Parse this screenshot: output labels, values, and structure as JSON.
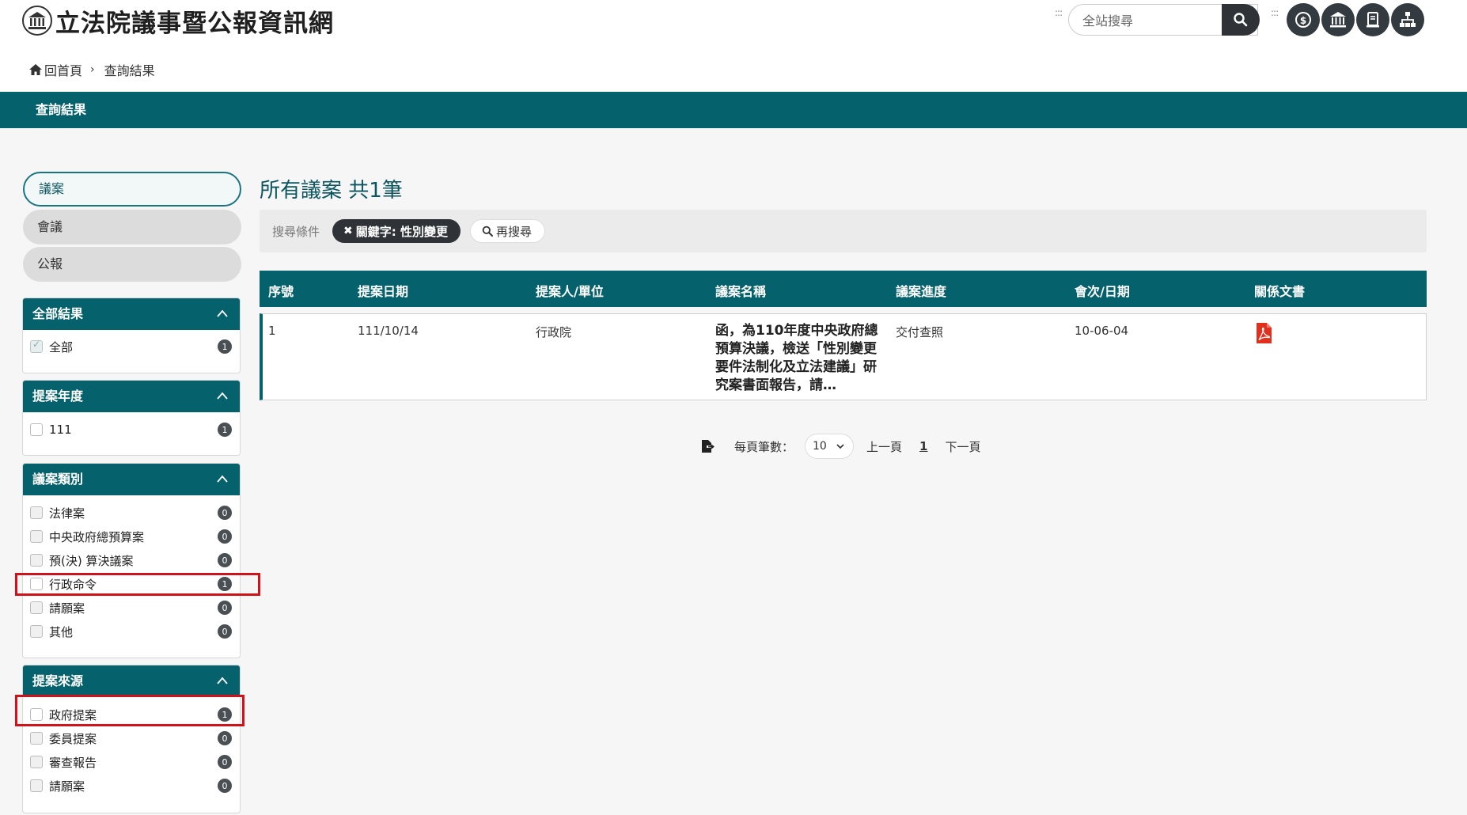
{
  "site": {
    "title": "立法院議事暨公報資訊網"
  },
  "search": {
    "placeholder": "全站搜尋"
  },
  "breadcrumb": {
    "home": "回首頁",
    "current": "查詢結果"
  },
  "banner": {
    "title": "查詢結果"
  },
  "sidebar": {
    "tabs": [
      {
        "label": "議案",
        "active": true
      },
      {
        "label": "會議",
        "active": false
      },
      {
        "label": "公報",
        "active": false
      }
    ],
    "panels": [
      {
        "title": "全部結果",
        "options": [
          {
            "label": "全部",
            "count": "1"
          }
        ]
      },
      {
        "title": "提案年度",
        "options": [
          {
            "label": "111",
            "count": "1"
          }
        ]
      },
      {
        "title": "議案類別",
        "options": [
          {
            "label": "法律案",
            "count": "0"
          },
          {
            "label": "中央政府總預算案",
            "count": "0"
          },
          {
            "label": "預(決) 算決議案",
            "count": "0"
          },
          {
            "label": "行政命令",
            "count": "1"
          },
          {
            "label": "請願案",
            "count": "0"
          },
          {
            "label": "其他",
            "count": "0"
          }
        ]
      },
      {
        "title": "提案來源",
        "options": [
          {
            "label": "政府提案",
            "count": "1"
          },
          {
            "label": "委員提案",
            "count": "0"
          },
          {
            "label": "審查報告",
            "count": "0"
          },
          {
            "label": "請願案",
            "count": "0"
          }
        ]
      }
    ]
  },
  "main": {
    "title": "所有議案 共1筆",
    "conditions": {
      "label": "搜尋條件",
      "keyword_chip": "關鍵字: 性別變更",
      "research_button": "再搜尋"
    },
    "table": {
      "headers": [
        "序號",
        "提案日期",
        "提案人/單位",
        "議案名稱",
        "議案進度",
        "會次/日期",
        "關係文書"
      ],
      "rows": [
        {
          "no": "1",
          "date": "111/10/14",
          "proposer": "行政院",
          "name": "函，為110年度中央政府總預算決議，檢送「性別變更要件法制化及立法建議」研究案書面報告，請…",
          "progress": "交付查照",
          "session": "10-06-04"
        }
      ]
    },
    "pager": {
      "per_page_label": "每頁筆數：",
      "per_page_value": "10",
      "prev": "上一頁",
      "current": "1",
      "next": "下一頁"
    }
  },
  "colors": {
    "teal": "#05616b",
    "dark": "#2f3338",
    "highlight": "#d0121b",
    "pdf": "#e0301e"
  }
}
